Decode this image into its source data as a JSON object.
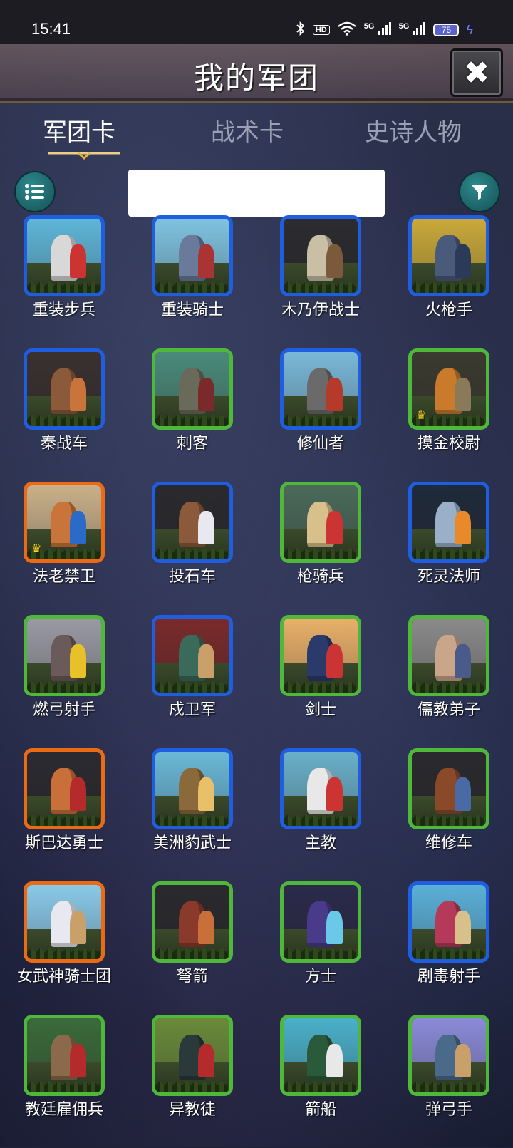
{
  "status_bar": {
    "time": "15:41",
    "hd_label": "HD",
    "signal1_label": "5G",
    "signal2_label": "5G",
    "battery_level": "75"
  },
  "header": {
    "title": "我的军团",
    "close_symbol": "✖"
  },
  "tabs": [
    {
      "label": "军团卡",
      "active": true
    },
    {
      "label": "战术卡",
      "active": false
    },
    {
      "label": "史诗人物",
      "active": false
    }
  ],
  "search": {
    "placeholder": ""
  },
  "colors": {
    "blue_frame": "#1f5ee0",
    "green_frame": "#4fb83b",
    "orange_frame": "#ec6a14",
    "teal_button": "#1f7a80"
  },
  "cards": [
    {
      "name": "重装步兵",
      "rarity": "blue",
      "crown": false,
      "palette": [
        "#5fb6d8",
        "#d8d8d8",
        "#c33"
      ]
    },
    {
      "name": "重装骑士",
      "rarity": "blue",
      "crown": false,
      "palette": [
        "#7fc3e0",
        "#6a7a9a",
        "#a33"
      ]
    },
    {
      "name": "木乃伊战士",
      "rarity": "blue",
      "crown": false,
      "palette": [
        "#2b2b30",
        "#c9bfa5",
        "#7a5a3a"
      ]
    },
    {
      "name": "火枪手",
      "rarity": "blue",
      "crown": false,
      "palette": [
        "#c9a93a",
        "#4a5a7a",
        "#2c3a5a"
      ]
    },
    {
      "name": "秦战车",
      "rarity": "blue",
      "crown": false,
      "palette": [
        "#3a3030",
        "#8a5a3a",
        "#c9743a"
      ]
    },
    {
      "name": "刺客",
      "rarity": "green",
      "crown": false,
      "palette": [
        "#4a8a7a",
        "#6a6a5a",
        "#7a2a2a"
      ]
    },
    {
      "name": "修仙者",
      "rarity": "blue",
      "crown": false,
      "palette": [
        "#7ab8d8",
        "#6a6a6a",
        "#b53a2a"
      ]
    },
    {
      "name": "摸金校尉",
      "rarity": "green",
      "crown": true,
      "palette": [
        "#3a3a30",
        "#c97a2a",
        "#8a7a5a"
      ]
    },
    {
      "name": "法老禁卫",
      "rarity": "orange",
      "crown": true,
      "palette": [
        "#c9b08a",
        "#c9743a",
        "#2a6ac9"
      ]
    },
    {
      "name": "投石车",
      "rarity": "blue",
      "crown": false,
      "palette": [
        "#2a2a2e",
        "#8a5a3a",
        "#e8e8f0"
      ]
    },
    {
      "name": "枪骑兵",
      "rarity": "green",
      "crown": false,
      "palette": [
        "#4a6a5a",
        "#d8c08a",
        "#c33"
      ]
    },
    {
      "name": "死灵法师",
      "rarity": "blue",
      "crown": false,
      "palette": [
        "#1f2a3a",
        "#9ab0c9",
        "#e88a2a"
      ]
    },
    {
      "name": "燃弓射手",
      "rarity": "green",
      "crown": false,
      "palette": [
        "#9a9aa5",
        "#6a5a5a",
        "#e8c02a"
      ]
    },
    {
      "name": "戍卫军",
      "rarity": "blue",
      "crown": false,
      "palette": [
        "#7a2a2a",
        "#3a6a5a",
        "#c9a06a"
      ]
    },
    {
      "name": "剑士",
      "rarity": "green",
      "crown": false,
      "palette": [
        "#e8b06a",
        "#2a3a6a",
        "#c33"
      ]
    },
    {
      "name": "儒教弟子",
      "rarity": "green",
      "crown": false,
      "palette": [
        "#8a8a8a",
        "#c9a58a",
        "#4a5a8a"
      ]
    },
    {
      "name": "斯巴达勇士",
      "rarity": "orange",
      "crown": false,
      "palette": [
        "#2a2a30",
        "#c9703a",
        "#b52a2a"
      ]
    },
    {
      "name": "美洲豹武士",
      "rarity": "blue",
      "crown": false,
      "palette": [
        "#6ab8d8",
        "#8a6a3a",
        "#e8c06a"
      ]
    },
    {
      "name": "主教",
      "rarity": "blue",
      "crown": false,
      "palette": [
        "#6ab0c9",
        "#e8e8e8",
        "#c33"
      ]
    },
    {
      "name": "维修车",
      "rarity": "green",
      "crown": false,
      "palette": [
        "#2a2a2e",
        "#8a4a2a",
        "#4a6aa5"
      ]
    },
    {
      "name": "女武神骑士团",
      "rarity": "orange",
      "crown": false,
      "palette": [
        "#8ac9e8",
        "#e8e8f0",
        "#c9a06a"
      ]
    },
    {
      "name": "弩箭",
      "rarity": "green",
      "crown": false,
      "palette": [
        "#2a2a2e",
        "#8a3a2a",
        "#c9703a"
      ]
    },
    {
      "name": "方士",
      "rarity": "green",
      "crown": false,
      "palette": [
        "#2a2a4a",
        "#4a3a8a",
        "#6ac9e8"
      ]
    },
    {
      "name": "剧毒射手",
      "rarity": "blue",
      "crown": false,
      "palette": [
        "#5ab0d8",
        "#b53a5a",
        "#d8c08a"
      ]
    },
    {
      "name": "教廷雇佣兵",
      "rarity": "green",
      "crown": false,
      "palette": [
        "#3a6a3a",
        "#8a6a4a",
        "#b52a2a"
      ]
    },
    {
      "name": "异教徒",
      "rarity": "green",
      "crown": false,
      "palette": [
        "#6a8a3a",
        "#2a3a3a",
        "#b52a2a"
      ]
    },
    {
      "name": "箭船",
      "rarity": "green",
      "crown": false,
      "palette": [
        "#4ab0c9",
        "#2a5a3a",
        "#e8e8e8"
      ]
    },
    {
      "name": "弹弓手",
      "rarity": "green",
      "crown": false,
      "palette": [
        "#8a8ad8",
        "#4a6a8a",
        "#c9a06a"
      ]
    }
  ]
}
